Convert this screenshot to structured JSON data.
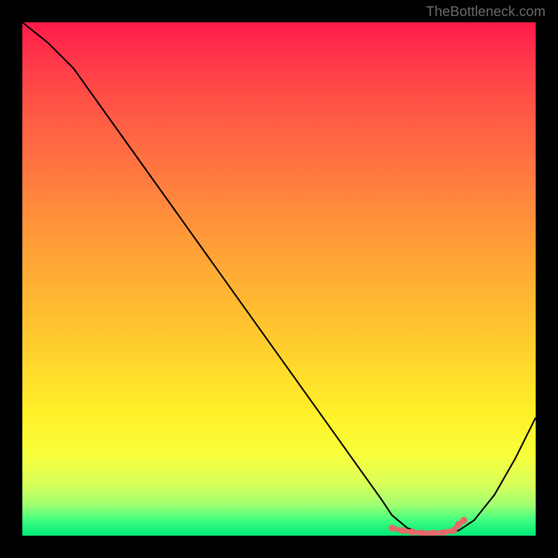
{
  "watermark": "TheBottleneck.com",
  "chart_data": {
    "type": "line",
    "title": "",
    "xlabel": "",
    "ylabel": "",
    "xlim": [
      0,
      100
    ],
    "ylim": [
      0,
      100
    ],
    "series": [
      {
        "name": "bottleneck-curve",
        "x": [
          0,
          5,
          10,
          15,
          20,
          25,
          30,
          35,
          40,
          45,
          50,
          55,
          60,
          65,
          70,
          72,
          75,
          78,
          80,
          82,
          85,
          88,
          92,
          96,
          100
        ],
        "y": [
          100,
          96,
          91,
          84,
          77,
          70,
          63,
          56,
          49,
          42,
          35,
          28,
          21,
          14,
          7,
          4,
          1.5,
          0.5,
          0.5,
          0.5,
          1,
          3,
          8,
          15,
          23
        ]
      }
    ],
    "markers": {
      "name": "optimal-range",
      "x": [
        72,
        74,
        76,
        78,
        80,
        82,
        84,
        85,
        86
      ],
      "y": [
        1.5,
        1.0,
        0.7,
        0.5,
        0.5,
        0.6,
        1.0,
        2.2,
        3.0
      ]
    },
    "gradient_meaning": "vertical position maps to bottleneck severity (top red = severe, bottom green = none)"
  }
}
